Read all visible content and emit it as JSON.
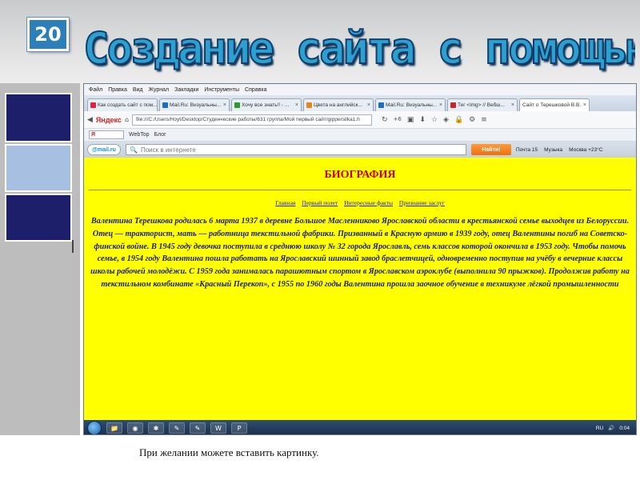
{
  "slide": {
    "number": "20",
    "title": "Создание сайта  с помощью блокнота",
    "note": "При желании можете вставить картинку."
  },
  "browser": {
    "menu": [
      "Файл",
      "Правка",
      "Вид",
      "Журнал",
      "Закладки",
      "Инструменты",
      "Справка"
    ],
    "tabs": [
      {
        "label": "Как создать сайт с пом...",
        "active": false
      },
      {
        "label": "Mail.Ru: Визуальны...",
        "active": false
      },
      {
        "label": "Хочу все знать!! - ...",
        "active": false
      },
      {
        "label": "Цвета на английск...",
        "active": false
      },
      {
        "label": "Mail.Ru: Визуальны...",
        "active": false
      },
      {
        "label": "Тег <img> // Вебш...",
        "active": false
      },
      {
        "label": "Сайт о Терешковой В.В.",
        "active": true
      }
    ],
    "yandex_label": "Яндекс",
    "url": "file:///C:/Users/Hoyt/Desktop/Студенческие работы/631 группа/Мой первый сайт/gippersilka1.h",
    "toolbar_badge": "+6",
    "bookmarks": {
      "input": "Я",
      "webtop": "WebTop",
      "blog": "Блог"
    },
    "mailru": {
      "logo": "@mail.ru",
      "search_placeholder": "Поиск в интернете",
      "find_button": "Найти!",
      "mail": "Почта 15",
      "music": "Музыка",
      "weather": "Москва +23°C"
    }
  },
  "page": {
    "heading": "БИОГРАФИЯ",
    "links": [
      "Главная",
      "Первый полет",
      "Интересные факты",
      "Признание заслуг"
    ],
    "bio": "Валентина Терешкова родилась 6 марта 1937 в деревне Большое Масленниково Ярославской области в крестьянской семье выходцев из Белоруссии. Отец — тракторист, мать — работница текстильной фабрики. Призванный в Красную армию в 1939 году, отец Валентины погиб на Советско-финской войне. В 1945 году девочка поступила в среднюю школу № 32 города Ярославль, семь классов которой окончила в 1953 году. Чтобы помочь семье, в 1954 году Валентина пошла работать на Ярославский шинный завод браслетчицей, одновременно поступив на учёбу в вечерние классы школы рабочей молодёжи. С 1959 года занималась парашютным спортом в Ярославском аэроклубе (выполнила 90 прыжков). Продолжив работу на текстильном комбинате «Красный Перекоп», с 1955 по 1960 годы Валентина прошла заочное обучение в техникуме лёгкой промышленности"
  },
  "taskbar": {
    "lang": "RU",
    "time": "0:04"
  },
  "colors": {
    "page_background": "#ffff00",
    "heading": "#c40000",
    "bio_text": "#1a1e6c",
    "title": "#2ea0d0"
  }
}
